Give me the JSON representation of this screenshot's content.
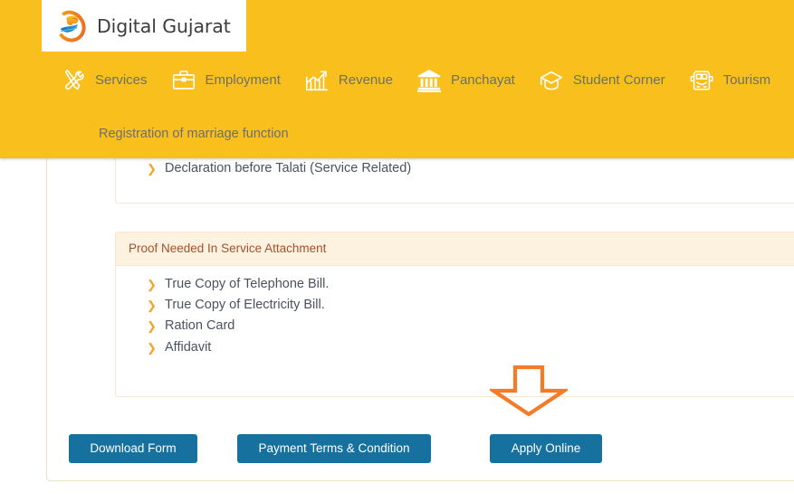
{
  "header": {
    "brand_name": "Digital Gujarat",
    "logo_icon": "digital-gujarat-lion-logo",
    "background_color": "#f9bf1d",
    "nav": [
      {
        "label": "Services",
        "icon": "tools-icon"
      },
      {
        "label": "Employment",
        "icon": "briefcase-icon"
      },
      {
        "label": "Revenue",
        "icon": "bar-chart-growth-icon"
      },
      {
        "label": "Panchayat",
        "icon": "government-building-icon"
      },
      {
        "label": "Student Corner",
        "icon": "graduation-cap-icon"
      },
      {
        "label": "Tourism",
        "icon": "bus-icon"
      }
    ],
    "breadcrumb": "Registration of marriage function"
  },
  "main": {
    "documents_panel": {
      "items": [
        {
          "icon": "chevron-right-icon",
          "text": "Declaration before Talati (Service Related)"
        }
      ]
    },
    "proof_panel": {
      "title": "Proof Needed In Service Attachment",
      "items": [
        {
          "icon": "chevron-right-icon",
          "text": "True Copy of Telephone Bill."
        },
        {
          "icon": "chevron-right-icon",
          "text": "True Copy of Electricity Bill."
        },
        {
          "icon": "chevron-right-icon",
          "text": "Ration Card"
        },
        {
          "icon": "chevron-right-icon",
          "text": "Affidavit"
        }
      ]
    },
    "buttons": {
      "download_form": "Download Form",
      "payment_terms": "Payment Terms & Condition",
      "apply_online": "Apply Online",
      "background_color": "#17719f"
    },
    "annotation": {
      "icon": "down-arrow-annotation",
      "color": "#f47b28",
      "points_to": "Apply Online"
    }
  },
  "theme": {
    "header_yellow": "#f9bf1d",
    "panel_header_beige": "#fdf2df",
    "panel_border": "#f7e7cf",
    "chevron_orange": "#f0a628",
    "body_text": "#4a5260",
    "panel_title_text": "#a0522d",
    "button_blue": "#17719f",
    "annotation_orange": "#f47b28"
  }
}
